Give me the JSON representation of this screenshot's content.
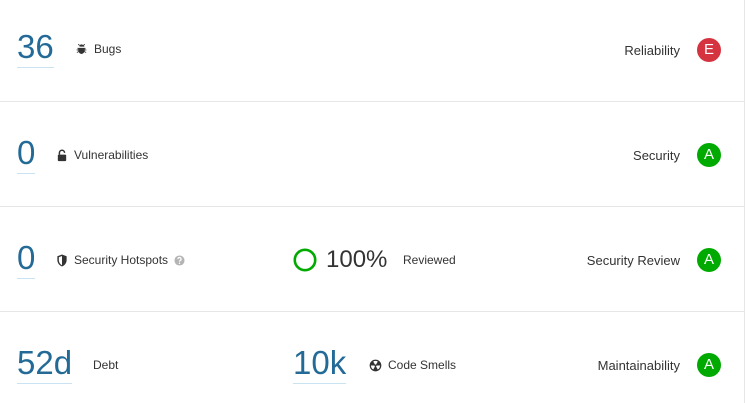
{
  "colors": {
    "measure_blue": "#236a97",
    "rating_e": "#d4333f",
    "rating_a": "#00aa00",
    "ring_green": "#00aa00"
  },
  "rows": [
    {
      "measure": "36",
      "label": "Bugs",
      "icon": "bug-icon",
      "rating_label": "Reliability",
      "rating": "E",
      "rating_color": "#d4333f"
    },
    {
      "measure": "0",
      "label": "Vulnerabilities",
      "icon": "lock-icon",
      "rating_label": "Security",
      "rating": "A",
      "rating_color": "#00aa00"
    },
    {
      "measure": "0",
      "label": "Security Hotspots",
      "icon": "shield-icon",
      "help_icon": "help-icon",
      "reviewed_percent": "100%",
      "reviewed_fraction": 1.0,
      "reviewed_label": "Reviewed",
      "rating_label": "Security Review",
      "rating": "A",
      "rating_color": "#00aa00"
    },
    {
      "measure": "52d",
      "label": "Debt",
      "secondary_measure": "10k",
      "secondary_label": "Code Smells",
      "secondary_icon": "code-smell-icon",
      "rating_label": "Maintainability",
      "rating": "A",
      "rating_color": "#00aa00"
    }
  ]
}
